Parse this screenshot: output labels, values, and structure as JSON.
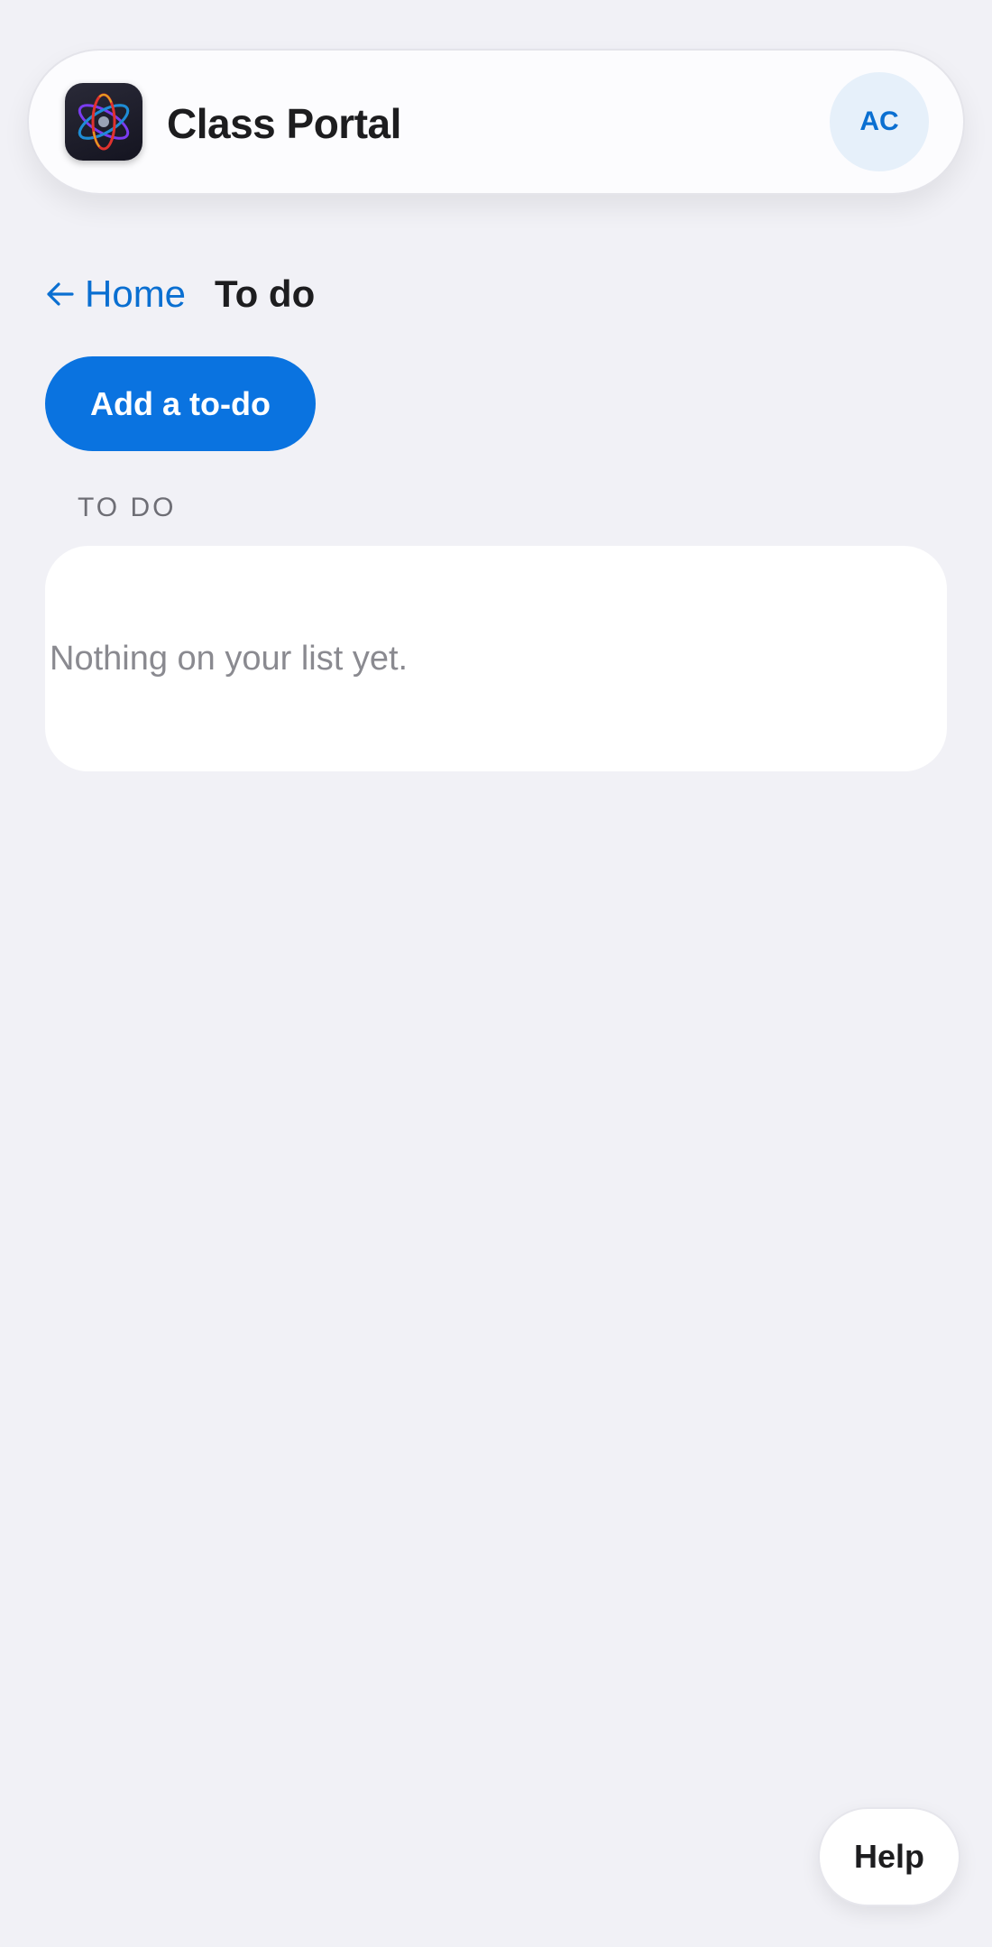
{
  "header": {
    "app_title": "Class Portal",
    "app_icon": "atom-icon",
    "avatar_initials": "AC"
  },
  "breadcrumb": {
    "back_icon": "arrow-left-icon",
    "back_label": "Home",
    "current": "To do"
  },
  "actions": {
    "add_label": "Add a to-do"
  },
  "list": {
    "section_label": "TO DO",
    "empty_message": "Nothing on your list yet."
  },
  "help": {
    "label": "Help"
  },
  "colors": {
    "accent": "#0a73e0",
    "link": "#0a6fd1",
    "background": "#f1f1f6",
    "avatar_bg": "#e6f0fa"
  }
}
